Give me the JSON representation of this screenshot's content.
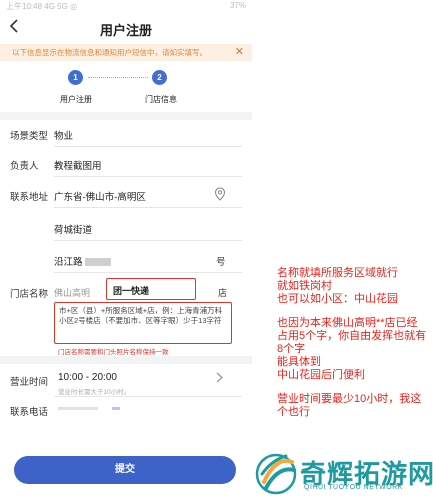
{
  "status_bar": {
    "left": "上午10:48  4G  5G  ◎",
    "right": "37%"
  },
  "nav": {
    "back_icon": "chevron-left-icon",
    "title": "用户注册"
  },
  "notice": {
    "text": "以下信息显示在物流信息和通知用户短信中，请如实填写。",
    "close": "✕"
  },
  "steps": [
    {
      "number": "1",
      "label": "用户注册"
    },
    {
      "number": "2",
      "label": "门店信息"
    }
  ],
  "form": {
    "venue_type": {
      "label": "场景类型",
      "value": "物业"
    },
    "contact_person": {
      "label": "负责人",
      "value": "教程截图用"
    },
    "address": {
      "label": "联系地址",
      "region": "广东省-佛山市-高明区",
      "street": "荷城街道",
      "road": "沿江路",
      "road_unit": "号"
    },
    "store_name": {
      "label": "门店名称",
      "prefix": "佛山高明",
      "value": "团一快递",
      "suffix": "店",
      "hint": "市+区（县）+所服务区域+店，例：上海青浦万科小区2号楼店（不要加市、区等字眼）少于13字符",
      "hint_small": "门店名称需要和门头照片名称保持一致"
    },
    "business_hours": {
      "label": "营业时间",
      "value": "10:00 - 20:00",
      "sub": "营业时长需大于10小时。"
    },
    "phone": {
      "label": "联系电话"
    }
  },
  "submit_label": "提交",
  "annotation": [
    "名称就填所服务区域就行",
    "就如铁岗村",
    "也可以如小区：中山花园",
    "",
    "也因为本来佛山高明**店已经",
    "占用5个字，你自由发挥也就有",
    "8个字",
    "能具体到",
    "中山花园后门便利",
    "",
    "营业时间要最少10小时，我这",
    "个也行"
  ],
  "watermark": {
    "name": "奇辉拓游网",
    "sub": "QIHUI TUOYOU NETWORK",
    "colors": {
      "primary": "#1f9aa0",
      "accent": "#f2a93b"
    }
  },
  "colors": {
    "accent_blue": "#3d63c8",
    "annotation_red": "#e8221c",
    "notice_bg": "#fdf0e3",
    "notice_text": "#e0863a"
  }
}
